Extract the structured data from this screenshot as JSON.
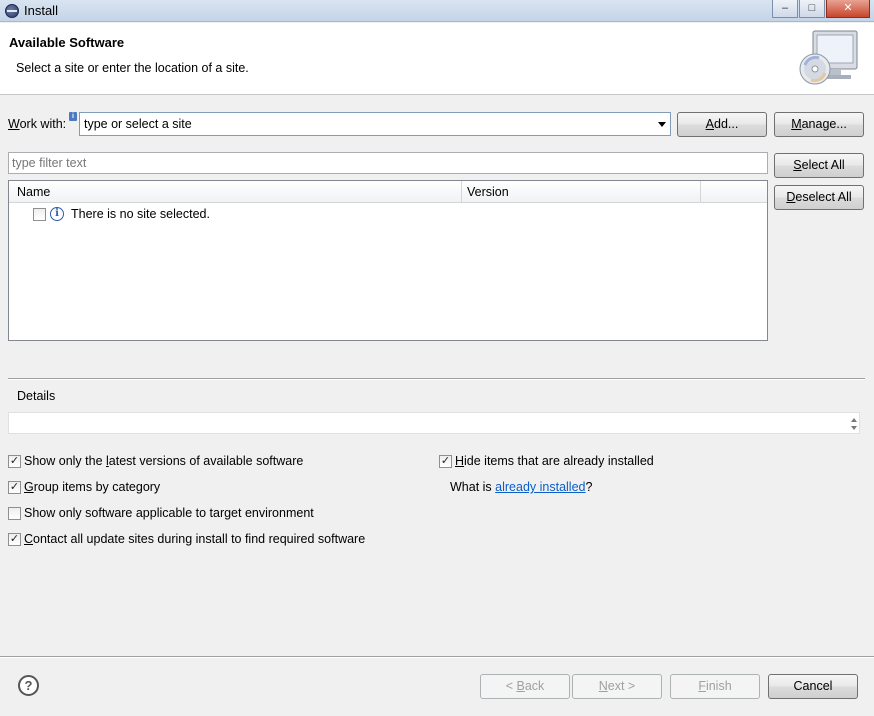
{
  "window": {
    "title": "Install",
    "minimize": "–",
    "maximize": "□",
    "close": "✕"
  },
  "header": {
    "title": "Available Software",
    "subtitle": "Select a site or enter the location of a site.",
    "banner_icon": "computer-cd-icon"
  },
  "work_with": {
    "label_mnemonic": "W",
    "label_rest": "ork with:",
    "combo_value": "type or select a site",
    "add_mnemonic": "A",
    "add_rest": "dd...",
    "manage_mnemonic": "M",
    "manage_rest": "anage..."
  },
  "filter": {
    "placeholder": "type filter text"
  },
  "side_buttons": {
    "select_all_mnemonic": "S",
    "select_all_rest": "elect All",
    "deselect_all_mnemonic": "D",
    "deselect_all_rest": "eselect All"
  },
  "table": {
    "columns": [
      "Name",
      "Version"
    ],
    "rows": [
      {
        "checked": false,
        "icon": "info-icon",
        "text": "There is no site selected."
      }
    ]
  },
  "details": {
    "label": "Details"
  },
  "options": {
    "latest": {
      "checked": true,
      "pre": "Show only the ",
      "mnemonic": "l",
      "post": "atest versions of available software"
    },
    "group": {
      "checked": true,
      "pre": "",
      "mnemonic": "G",
      "post": "roup items by category"
    },
    "target": {
      "checked": false,
      "pre": "Show only software applicable to target environment",
      "mnemonic": "",
      "post": ""
    },
    "contact": {
      "checked": true,
      "pre": "",
      "mnemonic": "C",
      "post": "ontact all update sites during install to find required software"
    },
    "hide": {
      "checked": true,
      "pre": "",
      "mnemonic": "H",
      "post": "ide items that are already installed"
    },
    "what_is_pre": "What is ",
    "what_is_link": "already installed",
    "what_is_post": "?"
  },
  "footer": {
    "help": "?",
    "back_pre": "< ",
    "back_mnemonic": "B",
    "back_rest": "ack",
    "next_mnemonic": "N",
    "next_rest": "ext >",
    "finish_mnemonic": "F",
    "finish_rest": "inish",
    "cancel": "Cancel"
  }
}
